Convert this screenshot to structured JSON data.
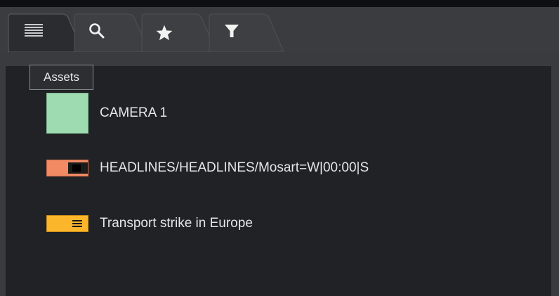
{
  "tabs": [
    {
      "name": "list",
      "icon": "list-icon"
    },
    {
      "name": "search",
      "icon": "search-icon"
    },
    {
      "name": "favorites",
      "icon": "star-icon"
    },
    {
      "name": "filter",
      "icon": "filter-icon"
    }
  ],
  "tooltip": {
    "text": "Assets"
  },
  "items": [
    {
      "label": "CAMERA 1",
      "icon": "camera-swatch-icon",
      "color": "#9fdbb0"
    },
    {
      "label": "HEADLINES/HEADLINES/Mosart=W|00:00|S",
      "icon": "graphics-swatch-icon",
      "color": "#f28a63"
    },
    {
      "label": "Transport strike in Europe",
      "icon": "story-swatch-icon",
      "color": "#fbb62b"
    }
  ],
  "colors": {
    "background": "#202226",
    "tab_active": "#2b2c2f",
    "tab_inactive": "#3e3f42",
    "text": "#e6e6e6"
  }
}
